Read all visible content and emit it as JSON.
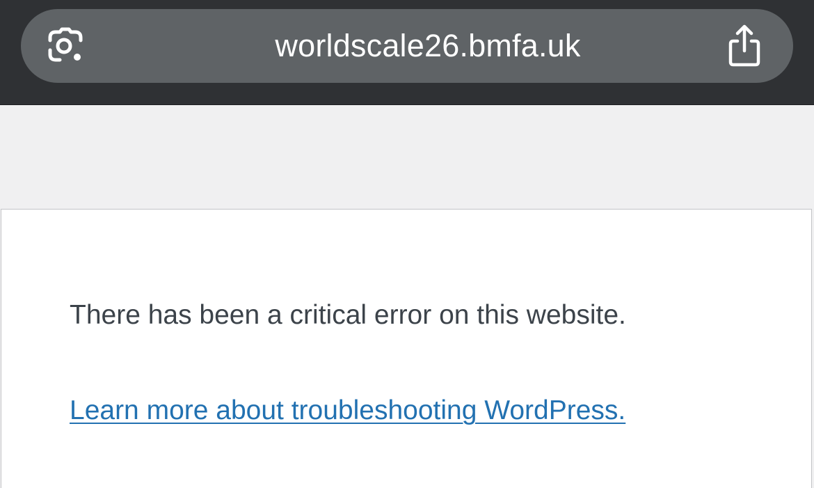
{
  "browser": {
    "url": "worldscale26.bmfa.uk",
    "left_icon": "lens-camera-icon",
    "right_icon": "share-icon"
  },
  "page": {
    "error_message": "There has been a critical error on this website.",
    "help_link_text": "Learn more about troubleshooting WordPress."
  },
  "colors": {
    "browser_bar": "#2f3134",
    "url_pill": "#5f6366",
    "page_background": "#f0f0f1",
    "text": "#3c434a",
    "link": "#2271b1"
  }
}
